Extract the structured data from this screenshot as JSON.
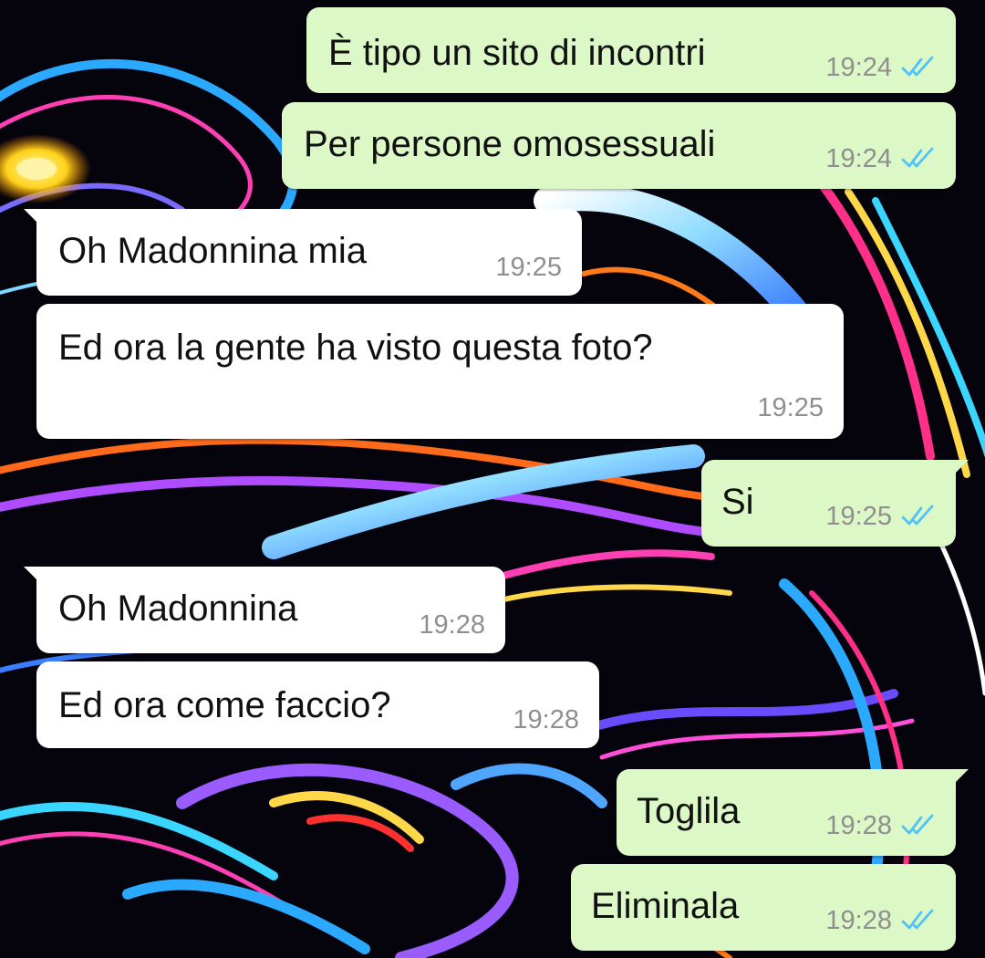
{
  "colors": {
    "outgoing_bubble": "#dcf8c6",
    "incoming_bubble": "#ffffff",
    "read_ticks": "#4fc3f7",
    "timestamp": "#8f8f8f"
  },
  "messages": [
    {
      "direction": "outgoing",
      "text": "È tipo un sito di incontri",
      "time": "19:24",
      "status_icon": "double-check-read-icon"
    },
    {
      "direction": "outgoing",
      "text": "Per persone omosessuali",
      "time": "19:24",
      "status_icon": "double-check-read-icon"
    },
    {
      "direction": "incoming",
      "text": "Oh Madonnina mia",
      "time": "19:25"
    },
    {
      "direction": "incoming",
      "text": "Ed ora la gente ha visto questa foto?",
      "time": "19:25"
    },
    {
      "direction": "outgoing",
      "text": "Si",
      "time": "19:25",
      "status_icon": "double-check-read-icon"
    },
    {
      "direction": "incoming",
      "text": "Oh Madonnina",
      "time": "19:28"
    },
    {
      "direction": "incoming",
      "text": "Ed ora come faccio?",
      "time": "19:28"
    },
    {
      "direction": "outgoing",
      "text": "Toglila",
      "time": "19:28",
      "status_icon": "double-check-read-icon"
    },
    {
      "direction": "outgoing",
      "text": "Eliminala",
      "time": "19:28",
      "status_icon": "double-check-read-icon"
    }
  ]
}
